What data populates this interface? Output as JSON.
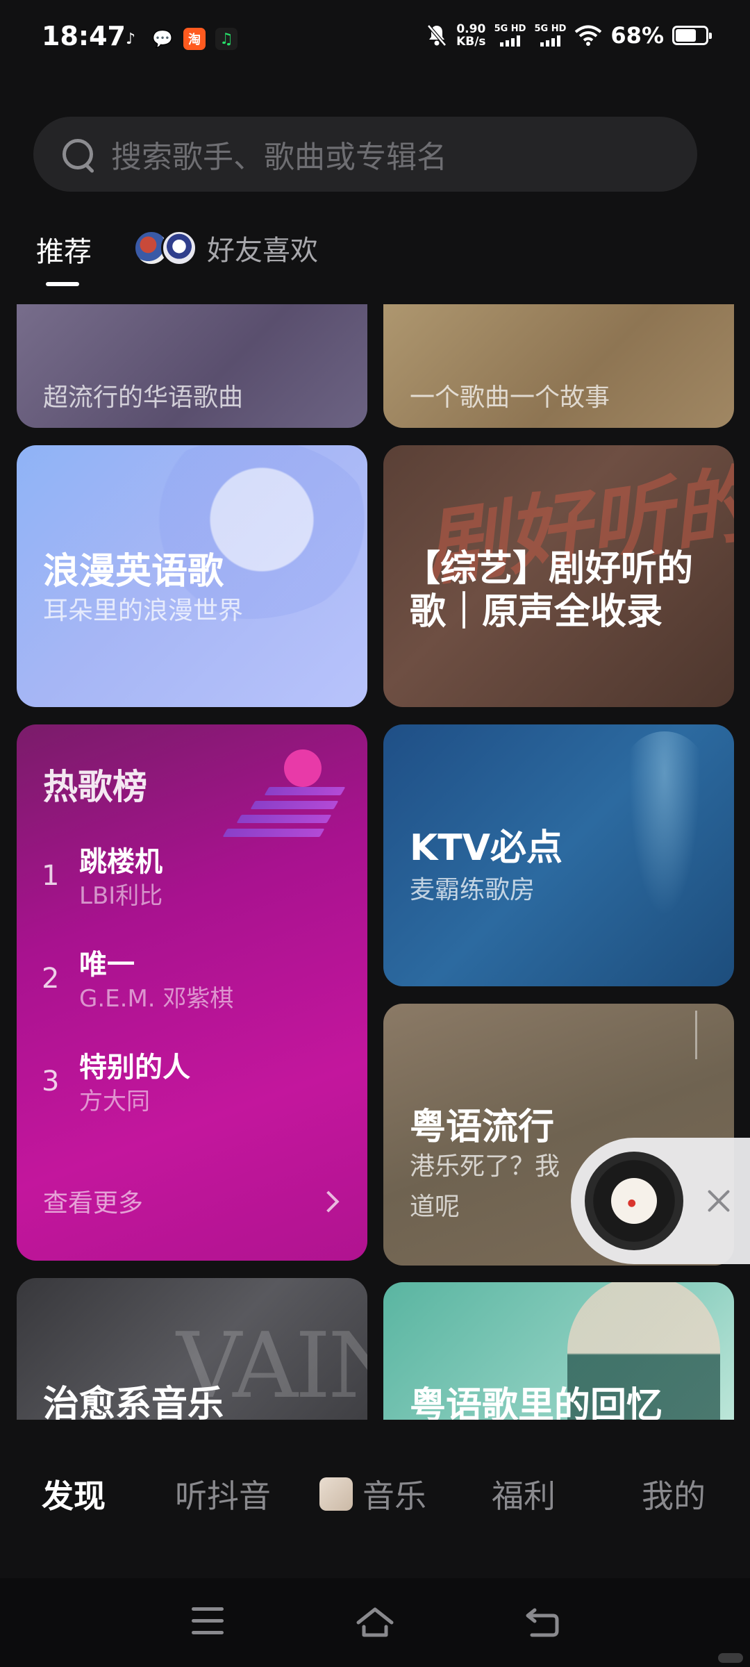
{
  "status_bar": {
    "time": "18:47",
    "net_speed_value": "0.90",
    "net_speed_unit": "KB/s",
    "sim1": "5G HD",
    "sim2": "5G HD",
    "battery": "68%",
    "battery_level": 0.68,
    "icons": [
      "notification-app-icon",
      "wechat-icon",
      "taobao-icon",
      "music-app-icon",
      "mute-bell-icon",
      "signal-icon",
      "wifi-icon",
      "battery-icon"
    ]
  },
  "search": {
    "placeholder": "搜索歌手、歌曲或专辑名"
  },
  "tabs": {
    "recommend": "推荐",
    "friends_like": "好友喜欢"
  },
  "cards": {
    "huayu": {
      "subtitle": "超流行的华语歌曲"
    },
    "story": {
      "subtitle": "一个歌曲一个故事"
    },
    "english": {
      "title": "浪漫英语歌",
      "subtitle": "耳朵里的浪漫世界"
    },
    "zongyi": {
      "title_line1": "【综艺】剧好听的",
      "title_line2": "歌｜原声全收录",
      "deco_text": "剧好听的"
    },
    "ktv": {
      "title": "KTV必点",
      "subtitle": "麦霸练歌房"
    },
    "yueyu": {
      "title": "粤语流行",
      "subtitle_line1": "港乐死了？我",
      "subtitle_line2": "道呢"
    },
    "healing": {
      "title": "治愈系音乐",
      "deco_text": "VAIN"
    },
    "memory": {
      "title": "粤语歌里的回忆"
    }
  },
  "hot_chart": {
    "title": "热歌榜",
    "items": [
      {
        "rank": "1",
        "song": "跳楼机",
        "artist": "LBI利比"
      },
      {
        "rank": "2",
        "song": "唯一",
        "artist": "G.E.M. 邓紫棋"
      },
      {
        "rank": "3",
        "song": "特别的人",
        "artist": "方大同"
      }
    ],
    "more": "查看更多"
  },
  "bottom_nav": {
    "discover": "发现",
    "douyin": "听抖音",
    "music": "音乐",
    "welfare": "福利",
    "mine": "我的"
  }
}
